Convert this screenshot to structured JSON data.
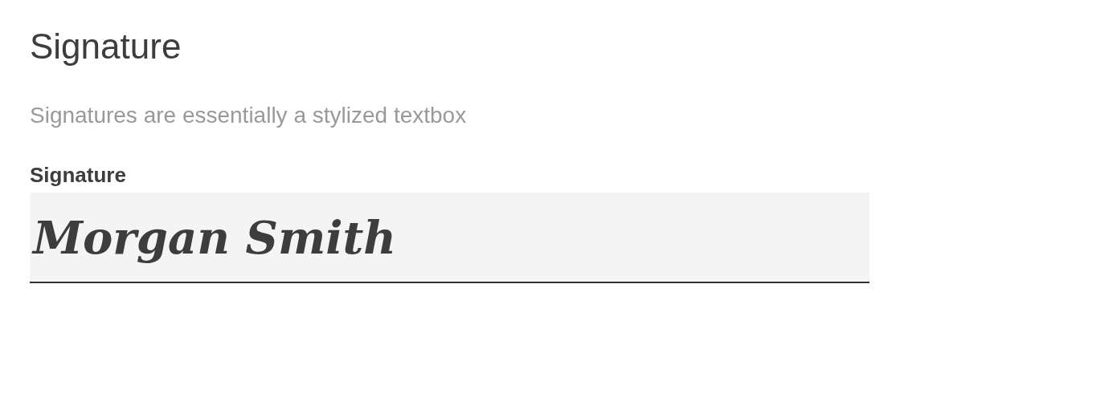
{
  "heading": "Signature",
  "description": "Signatures are essentially a stylized textbox",
  "field": {
    "label": "Signature",
    "value": "Morgan Smith"
  }
}
